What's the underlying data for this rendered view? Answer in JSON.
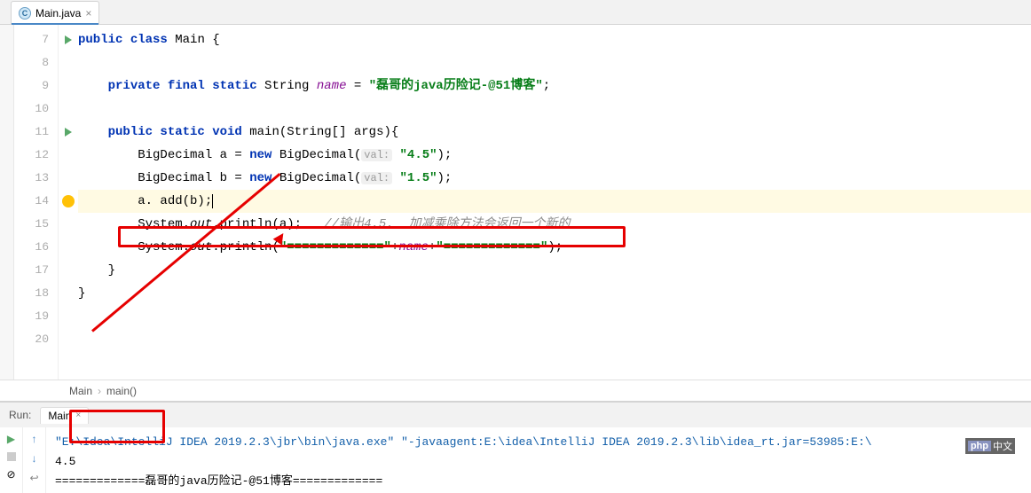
{
  "tab": {
    "filename": "Main.java",
    "icon_letter": "C"
  },
  "gutter": {
    "lines": [
      "7",
      "8",
      "9",
      "10",
      "11",
      "12",
      "13",
      "14",
      "15",
      "16",
      "17",
      "18",
      "19",
      "20"
    ]
  },
  "code": {
    "l7": {
      "kw1": "public",
      "kw2": "class",
      "name": "Main",
      "brace": " {"
    },
    "l9": {
      "kw": "private final static",
      "type": "String",
      "var": "name",
      "eq": " = ",
      "str": "\"磊哥的java历险记-@51博客\"",
      "semi": ";"
    },
    "l11": {
      "kw": "public static void",
      "name": "main",
      "args": "(String[] args){"
    },
    "l12": {
      "pre": "BigDecimal a = ",
      "kw": "new",
      "mid": " BigDecimal(",
      "hint": "val:",
      "str": " \"4.5\"",
      "end": ");"
    },
    "l13": {
      "pre": "BigDecimal b = ",
      "kw": "new",
      "mid": " BigDecimal(",
      "hint": "val:",
      "str": " \"1.5\"",
      "end": ");"
    },
    "l14": {
      "txt": "a. add(b);"
    },
    "l15": {
      "pre": "System.",
      "out": "out",
      "mid": ".println(a);   ",
      "cmt": "//输出4.5.  加减乘除方法会返回一个新的"
    },
    "l16": {
      "pre": "System.",
      "out": "out",
      "mid": ".println(",
      "str1": "\"=============\"",
      "plus1": "+",
      "name": "name",
      "plus2": "+",
      "str2": "\"=============\"",
      "end": ");"
    },
    "l17": {
      "txt": "}"
    },
    "l18": {
      "txt": "}"
    }
  },
  "breadcrumb": {
    "a": "Main",
    "b": "main()"
  },
  "run": {
    "label": "Run:",
    "tab": "Main",
    "cmd": "\"E:\\Idea\\IntelliJ IDEA 2019.2.3\\jbr\\bin\\java.exe\" \"-javaagent:E:\\idea\\IntelliJ IDEA 2019.2.3\\lib\\idea_rt.jar=53985:E:\\",
    "out1": "4.5",
    "out2": "=============磊哥的java历险记-@51博客============="
  },
  "badge": {
    "p": "php",
    "cn": "中文"
  }
}
